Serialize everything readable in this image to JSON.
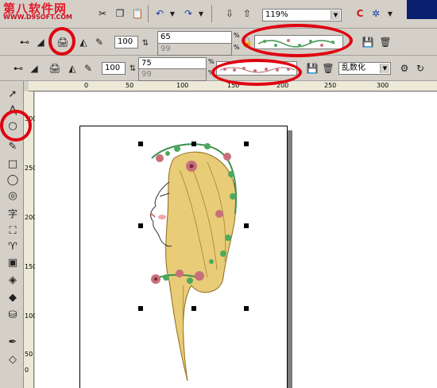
{
  "logo": {
    "cn": "第八软件网",
    "en": "WWW.D9SOFT.COM"
  },
  "toolbar_standard": {
    "zoom": "119%",
    "zoom_options": [
      "119%"
    ]
  },
  "artistic_media_bar": {
    "brush_width": "100",
    "smoothness": "65",
    "size_value": "99",
    "percent_1": "%",
    "percent_2": "%"
  },
  "artistic_media_bar_2": {
    "brush_width": "100",
    "smoothness": "75",
    "size_value": "99",
    "percent_1": "%",
    "percent_2": "%",
    "sequence_mode": "乱数化"
  },
  "ruler_h": {
    "ticks": [
      "0",
      "50",
      "100",
      "150",
      "200",
      "250",
      "300"
    ]
  },
  "ruler_v": {
    "ticks": [
      "300",
      "250",
      "200",
      "150",
      "100",
      "50",
      "0"
    ]
  },
  "colors": {
    "accent_red": "#e00010",
    "logo_red": "#e6192a",
    "hair": "#e8cc78",
    "leaf": "#4caa60",
    "flower": "#c8707a"
  }
}
